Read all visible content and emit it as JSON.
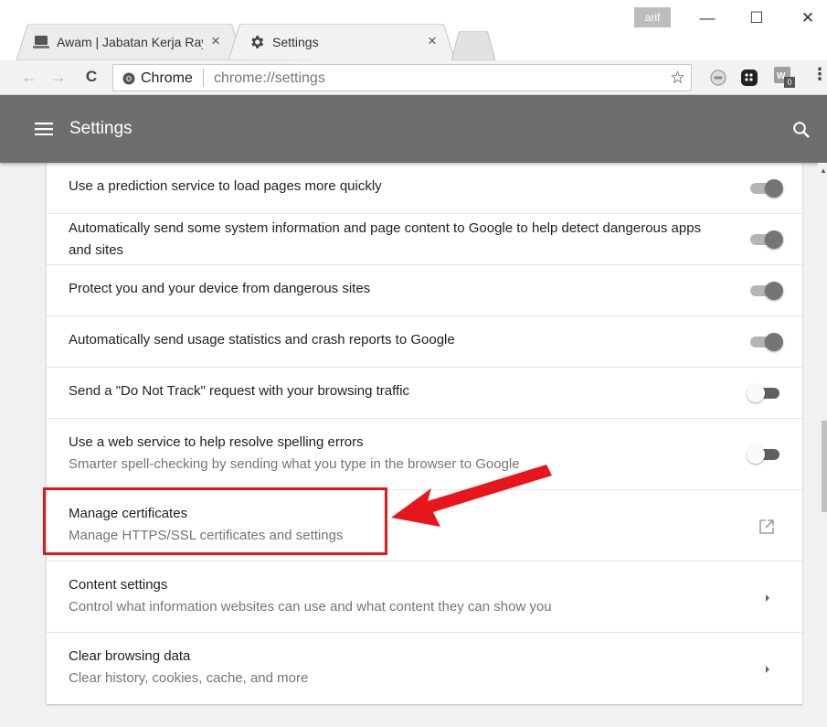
{
  "browser": {
    "tabs": [
      {
        "title": "Awam | Jabatan Kerja Raya",
        "close": "×"
      },
      {
        "title": "Settings",
        "close": "×"
      }
    ],
    "user_badge": "arif",
    "window_controls": {
      "minimize": "—",
      "maximize": "☐",
      "close": "✕"
    },
    "nav": {
      "back": "←",
      "forward": "→",
      "reload": "C"
    },
    "omnibox": {
      "site": "Chrome",
      "url": "chrome://settings",
      "star": "☆"
    },
    "extensions": [
      {
        "icon": "chat-extension-icon"
      },
      {
        "icon": "blackberry-extension-icon"
      },
      {
        "icon": "wp-extension-icon",
        "badge": "0"
      }
    ],
    "menu_dots": "⋮"
  },
  "header": {
    "title": "Settings",
    "menu_icon": "hamburger-menu-icon",
    "search_icon": "search-icon",
    "bg_color": "#6e6e6e"
  },
  "settings_rows": [
    {
      "primary": "Use a prediction service to load pages more quickly",
      "control": "toggle",
      "on": true
    },
    {
      "primary": "Automatically send some system information and page content to Google to help detect dangerous apps and sites",
      "control": "toggle",
      "on": true
    },
    {
      "primary": "Protect you and your device from dangerous sites",
      "control": "toggle",
      "on": true
    },
    {
      "primary": "Automatically send usage statistics and crash reports to Google",
      "control": "toggle",
      "on": true
    },
    {
      "primary": "Send a \"Do Not Track\" request with your browsing traffic",
      "control": "toggle",
      "on": false
    },
    {
      "primary": "Use a web service to help resolve spelling errors",
      "secondary": "Smarter spell-checking by sending what you type in the browser to Google",
      "control": "toggle",
      "on": false
    },
    {
      "primary": "Manage certificates",
      "secondary": "Manage HTTPS/SSL certificates and settings",
      "control": "external-link"
    },
    {
      "primary": "Content settings",
      "secondary": "Control what information websites can use and what content they can show you",
      "control": "chevron"
    },
    {
      "primary": "Clear browsing data",
      "secondary": "Clear history, cookies, cache, and more",
      "control": "chevron"
    }
  ],
  "annotation": {
    "highlight_color": "#e8161b"
  }
}
